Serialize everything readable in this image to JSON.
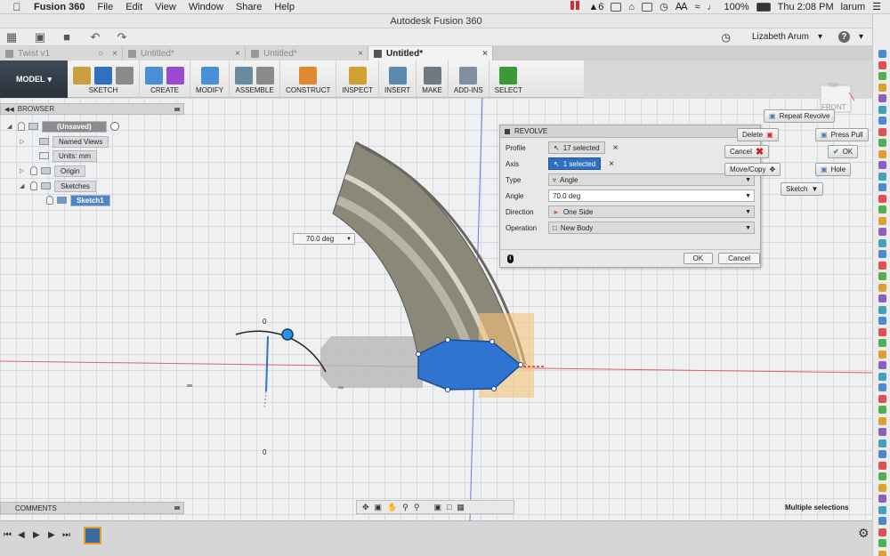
{
  "menubar": {
    "app_name": "Fusion 360",
    "items": [
      "File",
      "Edit",
      "View",
      "Window",
      "Share",
      "Help"
    ],
    "status_count": "6",
    "battery": "100%",
    "clock": "Thu 2:08 PM",
    "user_short": "larum"
  },
  "window": {
    "title": "Autodesk Fusion 360"
  },
  "appbar": {
    "user_name": "Lizabeth Arum",
    "help_label": "?"
  },
  "tabs": [
    {
      "label": "Twist v1",
      "active": false
    },
    {
      "label": "Untitled*",
      "active": false
    },
    {
      "label": "Untitled*",
      "active": false
    },
    {
      "label": "Untitled*",
      "active": true
    }
  ],
  "toolbar": {
    "workspace": "MODEL",
    "groups": [
      {
        "label": "SKETCH",
        "colors": [
          "#c8a040",
          "#3070c0",
          "#8a8a8a"
        ]
      },
      {
        "label": "CREATE",
        "colors": [
          "#4a90d9",
          "#9a4ad0"
        ]
      },
      {
        "label": "MODIFY",
        "colors": [
          "#4a90d9"
        ]
      },
      {
        "label": "ASSEMBLE",
        "colors": [
          "#6a8aa0",
          "#8a8a8a"
        ]
      },
      {
        "label": "CONSTRUCT",
        "colors": [
          "#e08a30"
        ]
      },
      {
        "label": "INSPECT",
        "colors": [
          "#d0a030"
        ]
      },
      {
        "label": "INSERT",
        "colors": [
          "#5a8ab0"
        ]
      },
      {
        "label": "MAKE",
        "colors": [
          "#707880"
        ]
      },
      {
        "label": "ADD-INS",
        "colors": [
          "#8090a0"
        ]
      },
      {
        "label": "SELECT",
        "colors": [
          "#3a9a3a"
        ]
      }
    ]
  },
  "browser": {
    "title": "BROWSER",
    "root": "(Unsaved)",
    "items": [
      "Named Views",
      "Units: mm",
      "Origin",
      "Sketches",
      "Sketch1"
    ]
  },
  "revolve": {
    "title": "REVOLVE",
    "profile_label": "Profile",
    "profile_value": "17 selected",
    "axis_label": "Axis",
    "axis_value": "1 selected",
    "type_label": "Type",
    "type_value": "Angle",
    "angle_label": "Angle",
    "angle_value": "70.0 deg",
    "direction_label": "Direction",
    "direction_value": "One Side",
    "operation_label": "Operation",
    "operation_value": "New Body",
    "ok_label": "OK",
    "cancel_label": "Cancel",
    "info_label": "i"
  },
  "marking_menu": {
    "repeat": "Repeat Revolve",
    "delete": "Delete",
    "press_pull": "Press Pull",
    "cancel": "Cancel",
    "ok": "OK",
    "move_copy": "Move/Copy",
    "hole": "Hole",
    "sketch": "Sketch"
  },
  "canvas": {
    "angle_chip": "70.0 deg",
    "viewcube_top": "TOP",
    "viewcube_front": "FRONT",
    "dim_zero": "0"
  },
  "comments": {
    "title": "COMMENTS"
  },
  "status": {
    "text": "Multiple selections"
  }
}
